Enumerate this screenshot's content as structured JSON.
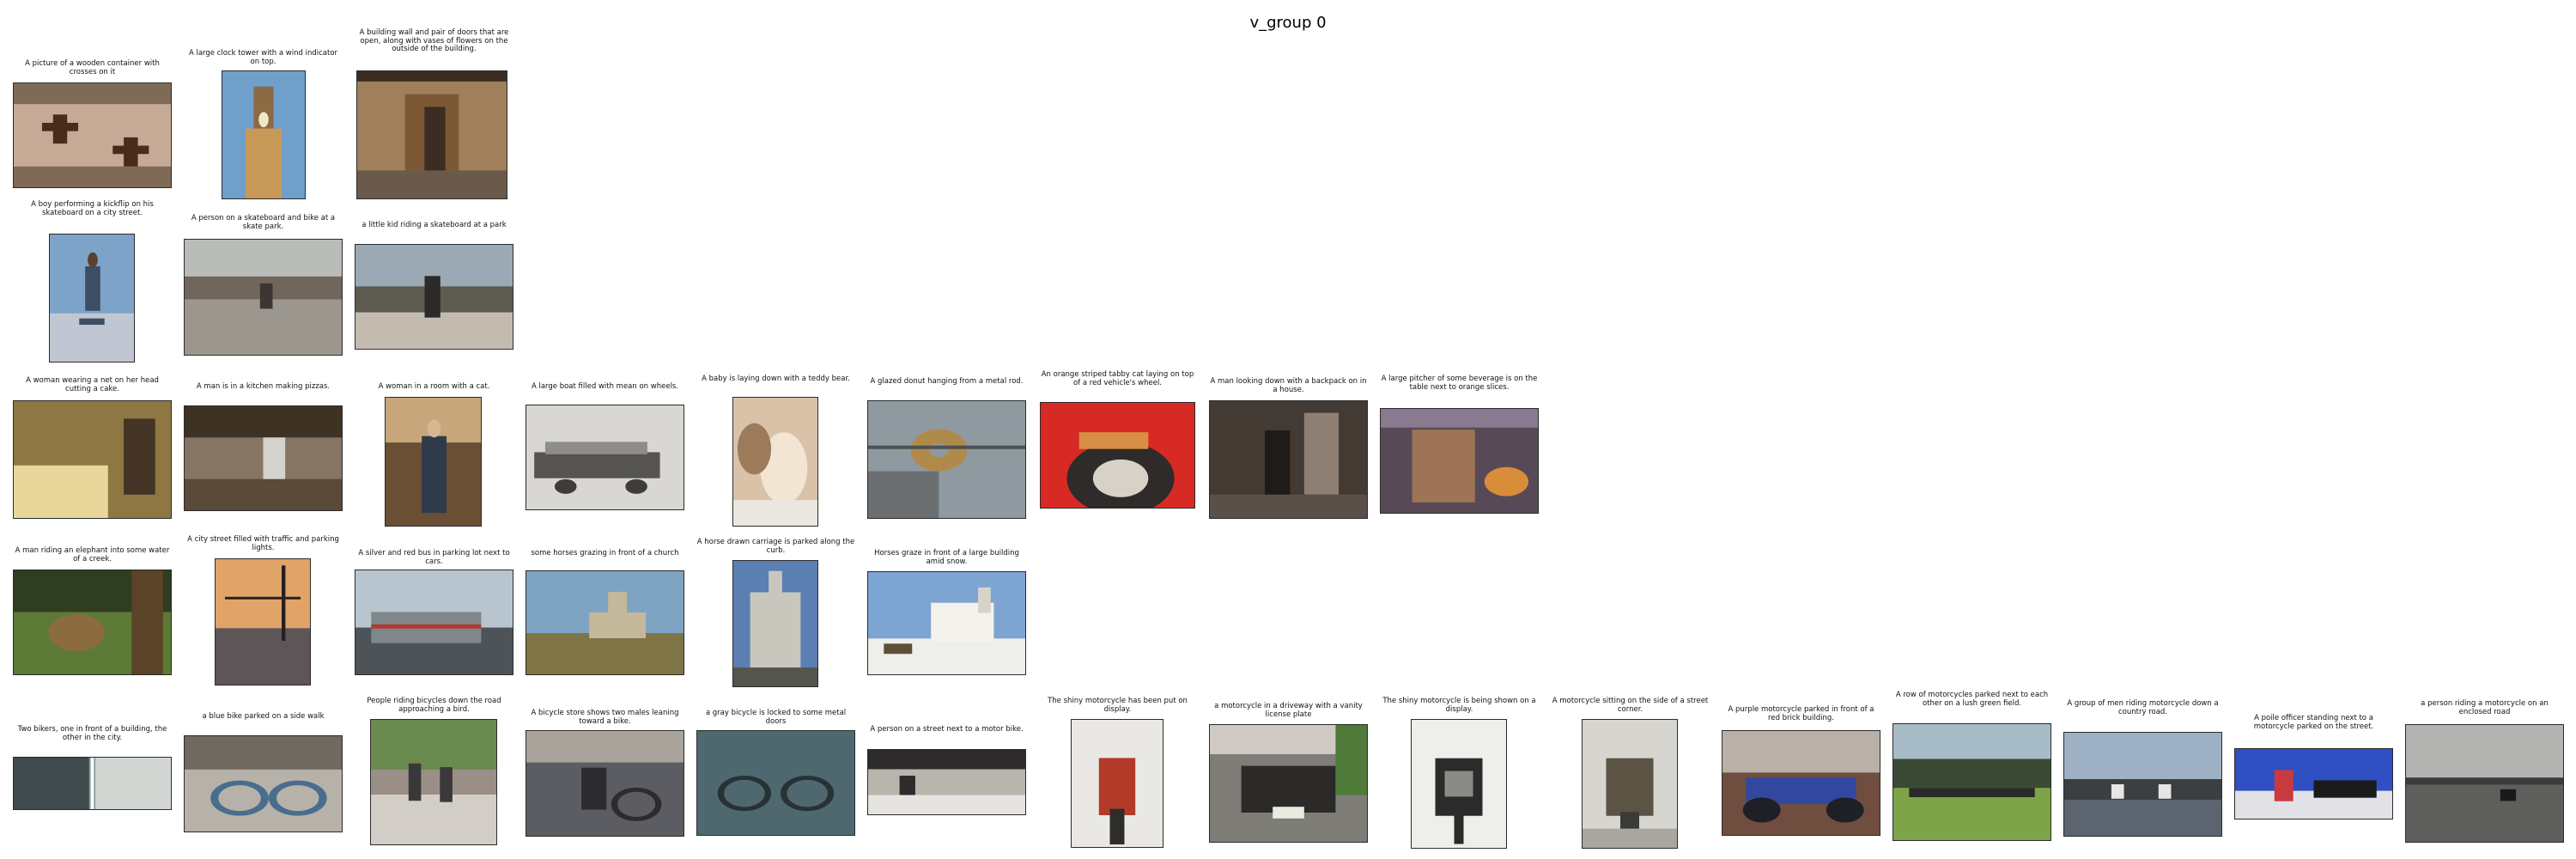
{
  "title": "v_group 0",
  "rows": [
    {
      "items": [
        {
          "caption": "A picture of a wooden container with crosses on it",
          "colors": [
            "#7f6a57",
            "#c5ab96",
            "#4b2c1a"
          ]
        },
        {
          "caption": "A large clock tower with a wind indicator on top.",
          "colors": [
            "#6f9fcb",
            "#8c6a44",
            "#c89a5a"
          ]
        },
        {
          "caption": "A building wall and pair of doors that are open, along with vases of flowers on the outside of the building.",
          "colors": [
            "#a07f5d",
            "#7d5834",
            "#3b2d23"
          ]
        }
      ]
    },
    {
      "items": [
        {
          "caption": "A boy performing a kickflip on his skateboard on a city street.",
          "colors": [
            "#7ea3c8",
            "#3d4e64",
            "#c0c6d2"
          ]
        },
        {
          "caption": "A person on a skateboard and bike at a skate park.",
          "colors": [
            "#babcb9",
            "#70665b",
            "#3b3631"
          ]
        },
        {
          "caption": "a little kid riding a skateboard at a park",
          "colors": [
            "#9aa9b4",
            "#5d5b4f",
            "#c4bbb0"
          ]
        }
      ]
    },
    {
      "items": [
        {
          "caption": "A woman wearing a net on her head cutting a cake.",
          "colors": [
            "#8e7743",
            "#e8d79b",
            "#433425"
          ]
        },
        {
          "caption": "A man is in a kitchen making pizzas.",
          "colors": [
            "#867562",
            "#3e3225",
            "#d4d2cd"
          ]
        },
        {
          "caption": "A woman in a room with a cat.",
          "colors": [
            "#6b4f35",
            "#c8a67b",
            "#2f3a4b"
          ]
        },
        {
          "caption": "A large boat filled with mean on wheels.",
          "colors": [
            "#d8d7d3",
            "#565451",
            "#8f8d88"
          ]
        },
        {
          "caption": "A baby is laying down with a teddy bear.",
          "colors": [
            "#d9c2a7",
            "#9b7b5a",
            "#f2e5d4"
          ]
        },
        {
          "caption": "A glazed donut hanging from a metal rod.",
          "colors": [
            "#8e9a9f",
            "#b08a4a",
            "#6b6f72"
          ]
        },
        {
          "caption": "An orange striped tabby cat laying on top of a red vehicle's wheel.",
          "colors": [
            "#d82a25",
            "#2f2b2a",
            "#d7d1c7"
          ]
        },
        {
          "caption": "A man looking down with a backpack on in a house.",
          "colors": [
            "#443a34",
            "#8d7f73",
            "#1f1b19"
          ]
        },
        {
          "caption": "A large pitcher of some beverage is on the table next to orange slices.",
          "colors": [
            "#9d7455",
            "#d88d38",
            "#574a56"
          ]
        }
      ]
    },
    {
      "items": [
        {
          "caption": "A man riding an elephant into some water of a creek.",
          "colors": [
            "#5c7a35",
            "#8a6c40",
            "#2f3d20"
          ]
        },
        {
          "caption": "A city street filled with traffic and parking lights.",
          "colors": [
            "#e0a468",
            "#5d5557",
            "#24201f"
          ]
        },
        {
          "caption": "A silver and red bus in parking lot next to cars.",
          "colors": [
            "#b8c4ce",
            "#7f878a",
            "#4d5356"
          ]
        },
        {
          "caption": "some horses grazing in front of a church",
          "colors": [
            "#7fa3c3",
            "#7e7445",
            "#c4b89a"
          ]
        },
        {
          "caption": "A horse drawn carriage is parked along the curb.",
          "colors": [
            "#5b7fb3",
            "#c9c7bd",
            "#55544d"
          ]
        },
        {
          "caption": "Horses graze in front of a large building amid snow.",
          "colors": [
            "#7ea4d2",
            "#eeeeea",
            "#5e4f37"
          ]
        }
      ]
    },
    {
      "items": [
        {
          "caption": "Two bikers, one in front of a building, the other in the city.",
          "colors": [
            "#8d9c9c",
            "#3f4b4d",
            "#d3d7d3"
          ]
        },
        {
          "caption": "a blue bike parked on a side walk",
          "colors": [
            "#b7b2a9",
            "#4a6d8d",
            "#6f6a60"
          ]
        },
        {
          "caption": "People riding bicycles down the road approaching a bird.",
          "colors": [
            "#6a8a4f",
            "#9a8f86",
            "#d2cdc7"
          ]
        },
        {
          "caption": "A bicycle store shows two males leaning toward a bike.",
          "colors": [
            "#5c5d63",
            "#a9a39b",
            "#2c2c30"
          ]
        },
        {
          "caption": "a gray bicycle is locked to some metal doors",
          "colors": [
            "#405b63",
            "#6d8086",
            "#263235"
          ]
        },
        {
          "caption": "A person on a street next to a motor bike.",
          "colors": [
            "#b9b5ad",
            "#2d2b2b",
            "#e6e4e0"
          ]
        },
        {
          "caption": "The shiny motorcycle has been put on display.",
          "colors": [
            "#e9e8e5",
            "#b23b2a",
            "#2f2d2b"
          ]
        },
        {
          "caption": "a motorcycle in a driveway with a vanity license plate",
          "colors": [
            "#7f7d78",
            "#2b2a29",
            "#cfcac3"
          ]
        },
        {
          "caption": "The shiny motorcycle is being shown on a display.",
          "colors": [
            "#eeeeea",
            "#2b2b2b",
            "#8c8a86"
          ]
        },
        {
          "caption": "A motorcycle sitting on the side of a street corner.",
          "colors": [
            "#d6d5d0",
            "#5b5344",
            "#3a3a38"
          ]
        },
        {
          "caption": "A purple motorcycle parked in front of a red brick building.",
          "colors": [
            "#6f4d3f",
            "#3248a0",
            "#b9b1a7"
          ]
        },
        {
          "caption": "A row of motorcycles parked next to each other on a lush green field.",
          "colors": [
            "#7da548",
            "#3a4a35",
            "#a8bcc8"
          ]
        },
        {
          "caption": "A group of men riding motorcycle down a country road.",
          "colors": [
            "#9eb1c4",
            "#5c6470",
            "#3b3f42"
          ]
        },
        {
          "caption": "A poile officer standing next to a motorcycle parked on the street.",
          "colors": [
            "#2f4fc2",
            "#c93a3f",
            "#e2e2e6"
          ]
        },
        {
          "caption": "a person riding a motorcycle on an enclosed road",
          "colors": [
            "#b3b3b1",
            "#5e5e5c",
            "#3b3b3a"
          ]
        }
      ]
    }
  ]
}
